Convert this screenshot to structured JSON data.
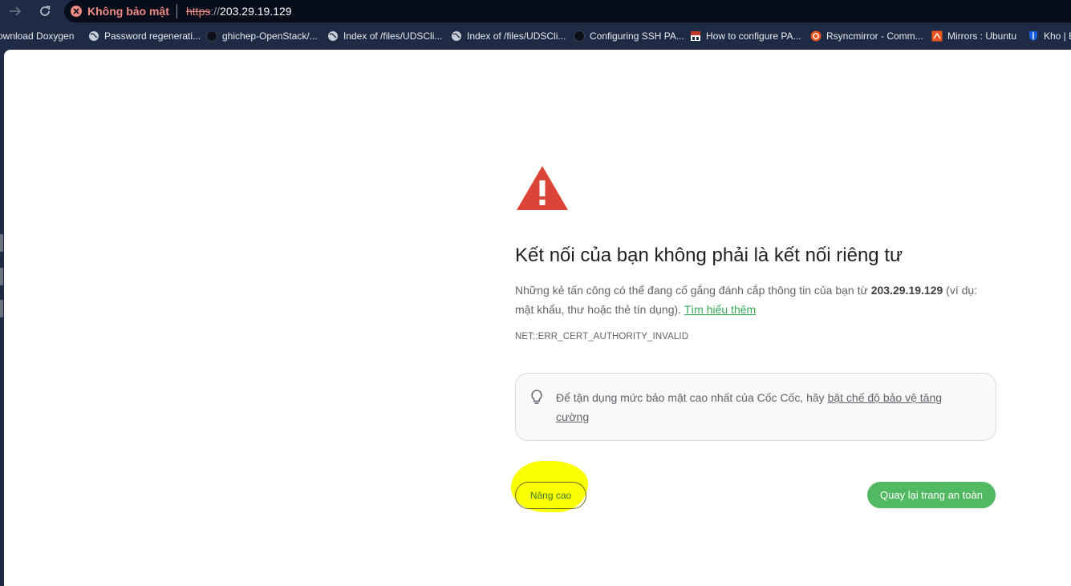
{
  "toolbar": {
    "security_label": "Không bảo mật",
    "url_scheme": "https",
    "url_slashes": "://",
    "url_host": "203.29.19.129"
  },
  "bookmarks": [
    {
      "label": "ownload Doxygen",
      "icon": "none"
    },
    {
      "label": "Password regenerati...",
      "icon": "globe-icon"
    },
    {
      "label": "ghichep-OpenStack/...",
      "icon": "github-icon"
    },
    {
      "label": "Index of /files/UDSCli...",
      "icon": "globe-icon"
    },
    {
      "label": "Index of /files/UDSCli...",
      "icon": "globe-icon"
    },
    {
      "label": "Configuring SSH PA...",
      "icon": "github-icon"
    },
    {
      "label": "How to configure PA...",
      "icon": "site-icon"
    },
    {
      "label": "Rsyncmirror - Comm...",
      "icon": "ubuntu-icon"
    },
    {
      "label": "Mirrors : Ubuntu",
      "icon": "launchpad-icon"
    },
    {
      "label": "Kho | E",
      "icon": "shield-icon"
    }
  ],
  "page": {
    "title": "Kết nối của bạn không phải là kết nối riêng tư",
    "desc_part1": "Những kẻ tấn công có thể đang cố gắng đánh cắp thông tin của bạn từ ",
    "desc_host": "203.29.19.129",
    "desc_part2": " (ví dụ: mật khẩu, thư hoặc thẻ tín dụng). ",
    "learn_more": "Tìm hiểu thêm",
    "error_code": "NET::ERR_CERT_AUTHORITY_INVALID",
    "tip_text": "Để tận dụng mức bảo mật cao nhất của Cốc Cốc, hãy ",
    "tip_link": "bật chế độ bảo vệ tăng cường",
    "advanced_button": "Nâng cao",
    "back_button": "Quay lại trang an toàn"
  },
  "colors": {
    "warning_red": "#db4437",
    "primary_green": "#52b963",
    "highlight_yellow": "#fbff00"
  }
}
